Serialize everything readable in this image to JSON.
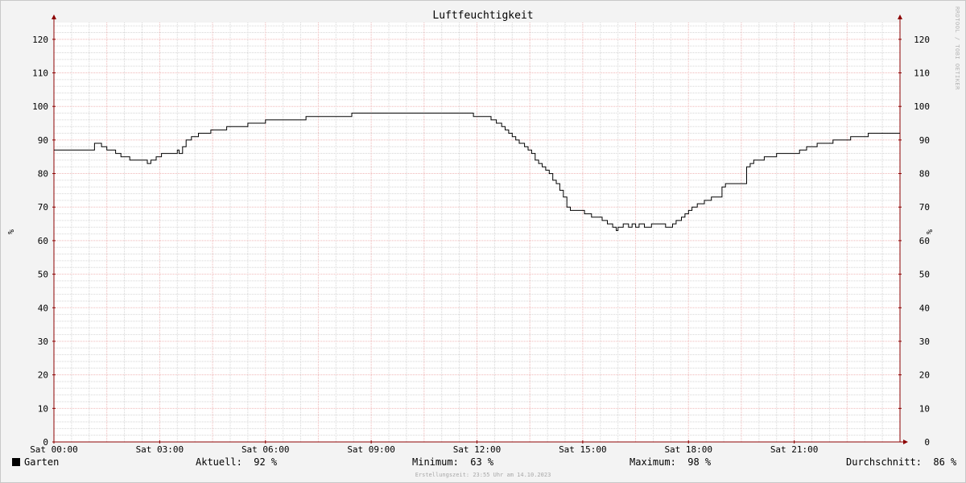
{
  "chart_data": {
    "type": "line",
    "title": "Luftfeuchtigkeit",
    "ylabel": "%",
    "ylim": [
      0,
      125
    ],
    "yticks": [
      0,
      10,
      20,
      30,
      40,
      50,
      60,
      70,
      80,
      90,
      100,
      110,
      120
    ],
    "xlim_hours": [
      0,
      24
    ],
    "xticks": [
      {
        "hour": 0,
        "label": "Sat 00:00"
      },
      {
        "hour": 3,
        "label": "Sat 03:00"
      },
      {
        "hour": 6,
        "label": "Sat 06:00"
      },
      {
        "hour": 9,
        "label": "Sat 09:00"
      },
      {
        "hour": 12,
        "label": "Sat 12:00"
      },
      {
        "hour": 15,
        "label": "Sat 15:00"
      },
      {
        "hour": 18,
        "label": "Sat 18:00"
      },
      {
        "hour": 21,
        "label": "Sat 21:00"
      }
    ],
    "grid": true,
    "series": [
      {
        "name": "Garten",
        "color": "#000000",
        "step": true,
        "x": [
          0.0,
          1.15,
          1.35,
          1.5,
          1.75,
          1.9,
          2.15,
          2.65,
          2.75,
          2.9,
          3.05,
          3.5,
          3.55,
          3.65,
          3.75,
          3.9,
          4.1,
          4.45,
          4.9,
          5.5,
          6.0,
          7.15,
          8.45,
          11.9,
          12.4,
          12.55,
          12.7,
          12.8,
          12.9,
          13.0,
          13.1,
          13.2,
          13.35,
          13.45,
          13.55,
          13.65,
          13.75,
          13.85,
          13.95,
          14.05,
          14.15,
          14.25,
          14.35,
          14.45,
          14.55,
          14.65,
          14.8,
          15.05,
          15.25,
          15.55,
          15.7,
          15.85,
          15.95,
          16.0,
          16.05,
          16.15,
          16.3,
          16.4,
          16.5,
          16.6,
          16.75,
          16.95,
          17.35,
          17.55,
          17.65,
          17.8,
          17.9,
          18.0,
          18.1,
          18.25,
          18.45,
          18.65,
          18.95,
          19.05,
          19.65,
          19.75,
          19.85,
          20.15,
          20.5,
          21.15,
          21.35,
          21.65,
          22.1,
          22.6,
          23.1,
          24.0
        ],
        "y": [
          87,
          89,
          88,
          87,
          86,
          85,
          84,
          83,
          84,
          85,
          86,
          87,
          86,
          88,
          90,
          91,
          92,
          93,
          94,
          95,
          96,
          97,
          98,
          97,
          96,
          95,
          94,
          93,
          92,
          91,
          90,
          89,
          88,
          87,
          86,
          84,
          83,
          82,
          81,
          80,
          78,
          77,
          75,
          73,
          70,
          69,
          69,
          68,
          67,
          66,
          65,
          64,
          63,
          64,
          64,
          65,
          64,
          65,
          64,
          65,
          64,
          65,
          64,
          65,
          66,
          67,
          68,
          69,
          70,
          71,
          72,
          73,
          76,
          77,
          82,
          83,
          84,
          85,
          86,
          87,
          88,
          89,
          90,
          91,
          92,
          92
        ]
      }
    ]
  },
  "legend": {
    "name": "Garten",
    "current": "Aktuell:  92 %",
    "minimum": "Minimum:  63 %",
    "maximum": "Maximum:  98 %",
    "average": "Durchschnitt:  86 %"
  },
  "footer": "Erstellungszeit: 23:55 Uhr am 14.10.2023",
  "watermark": "RRDTOOL / TOBI OETIKER",
  "colors": {
    "background": "#f3f3f3",
    "plot_background": "#ffffff",
    "major_grid": "#f0b8b8",
    "minor_grid": "#d6d6d6",
    "axis": "#8c0000",
    "line": "#000000"
  }
}
